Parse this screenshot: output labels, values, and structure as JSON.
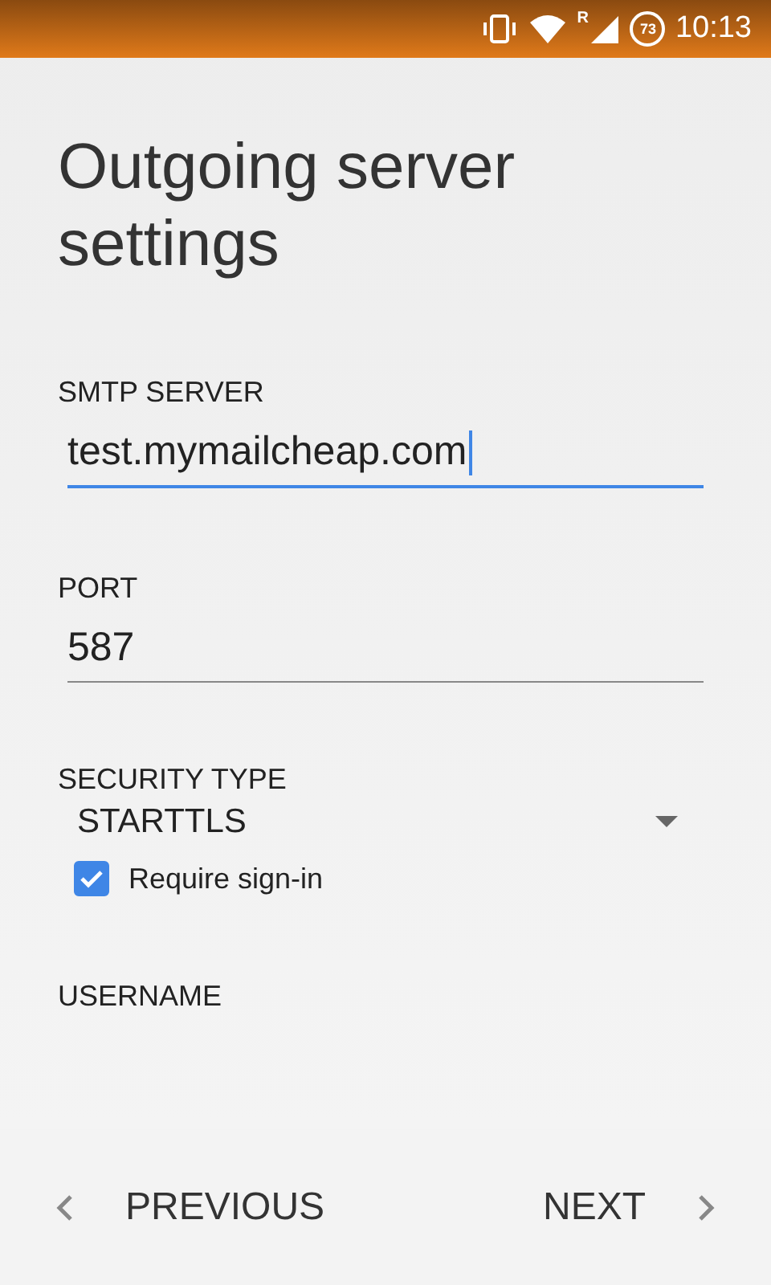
{
  "status_bar": {
    "battery": "73",
    "time": "10:13",
    "roaming": "R"
  },
  "title": "Outgoing server settings",
  "fields": [
    {
      "label": "SMTP SERVER",
      "value": "test.mymailcheap.com",
      "focused": true
    },
    {
      "label": "PORT",
      "value": "587",
      "focused": false
    }
  ],
  "security": {
    "label": "SECURITY TYPE",
    "value": "STARTTLS"
  },
  "require_signin": {
    "label": "Require sign-in",
    "checked": true
  },
  "username": {
    "label": "USERNAME"
  },
  "nav": {
    "previous": "PREVIOUS",
    "next": "NEXT"
  }
}
